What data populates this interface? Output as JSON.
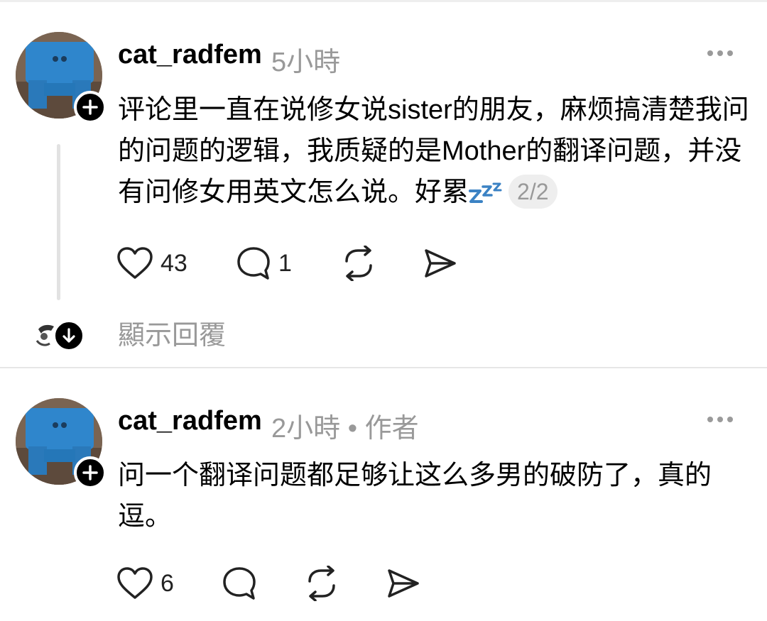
{
  "comments": [
    {
      "username": "cat_radfem",
      "time": "5小時",
      "text_before_icon": "评论里一直在说修女说sister的朋友，麻烦搞清楚我问的问题的逻辑，我质疑的是Mother的翻译问题，并没有问修女用英文怎么说。好累",
      "emoji_icon": "zzz-sleep-icon",
      "page_indicator": "2/2",
      "likes": "43",
      "replies": "1",
      "show_replies_label": "顯示回覆"
    },
    {
      "username": "cat_radfem",
      "time": "2小時",
      "author_separator": "•",
      "author_label": "作者",
      "text": "问一个翻译问题都足够让这么多男的破防了，真的逗。",
      "likes": "6",
      "replies": ""
    }
  ],
  "colors": {
    "text_primary": "#000000",
    "text_secondary": "#999999",
    "emoji_blue": "#3b82c4",
    "badge_bg": "#eeeeee"
  }
}
